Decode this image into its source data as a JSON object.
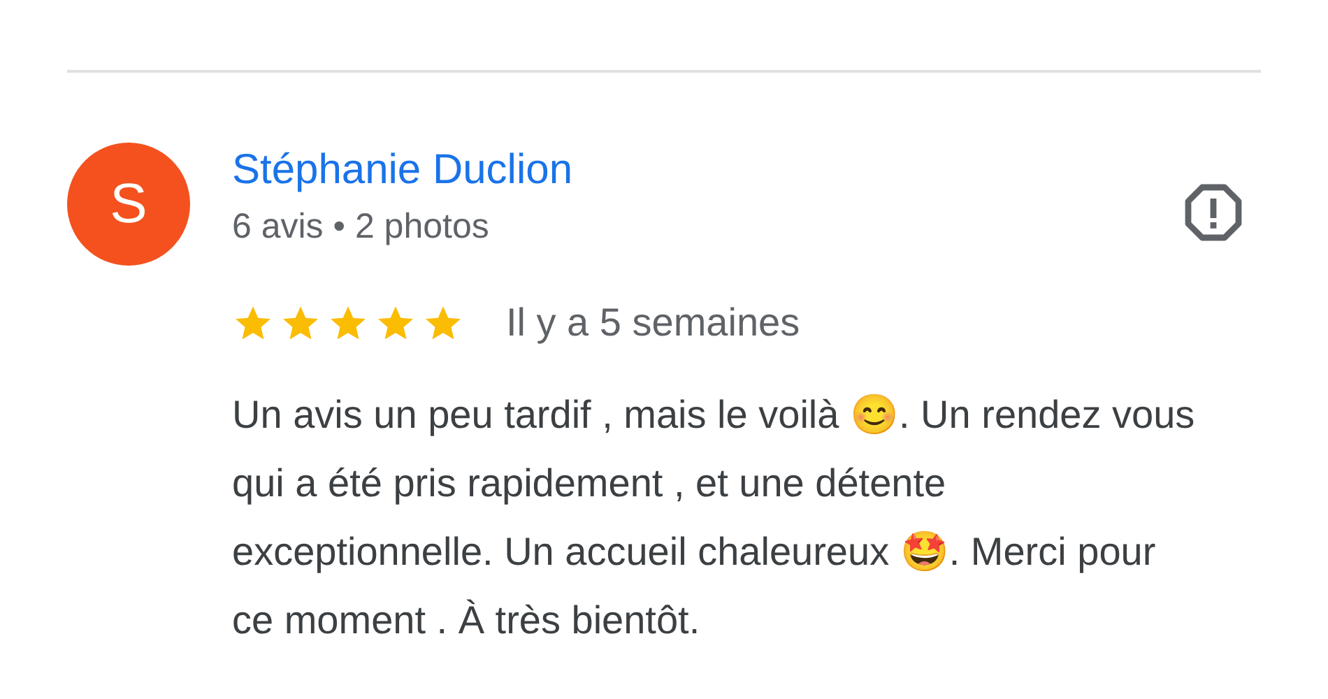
{
  "review": {
    "avatar_letter": "S",
    "author": "Stéphanie Duclion",
    "meta": "6 avis • 2 photos",
    "stars": 5,
    "time": "Il y a 5 semaines",
    "text": "Un avis un peu tardif , mais le voilà 😊. Un rendez vous qui a été pris rapidement , et une détente exceptionnelle. Un accueil chaleureux 🤩. Merci pour ce moment . À très bientôt."
  }
}
